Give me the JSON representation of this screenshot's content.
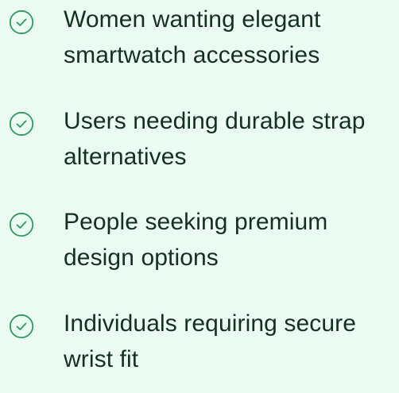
{
  "theme": {
    "background": "#edfcf3",
    "text_color": "#14301f",
    "icon_color": "#2e9a5d"
  },
  "audience_list": {
    "items": [
      {
        "icon": "check-circle-icon",
        "label": "Women wanting elegant smartwatch accessories"
      },
      {
        "icon": "check-circle-icon",
        "label": "Users needing durable strap alternatives"
      },
      {
        "icon": "check-circle-icon",
        "label": "People seeking premium design options"
      },
      {
        "icon": "check-circle-icon",
        "label": "Individuals requiring secure wrist fit"
      }
    ]
  }
}
